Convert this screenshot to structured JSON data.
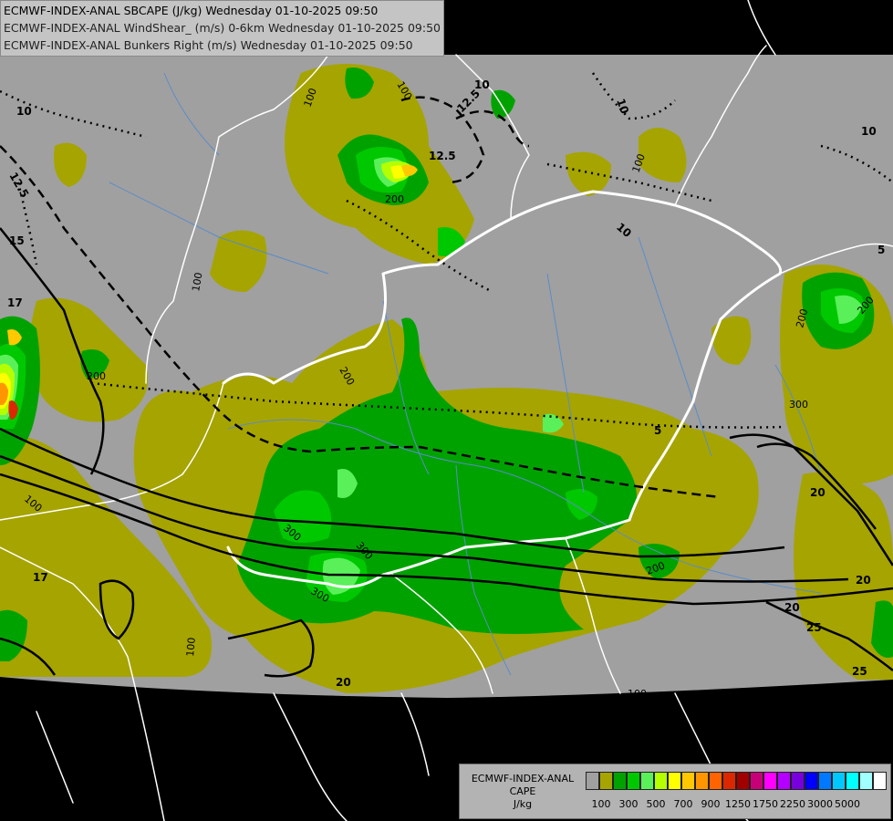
{
  "header": {
    "line1": "ECMWF-INDEX-ANAL SBCAPE (J/kg) Wednesday 01-10-2025 09:50",
    "line2": "ECMWF-INDEX-ANAL WindShear_ (m/s) 0-6km Wednesday 01-10-2025 09:50",
    "line3": "ECMWF-INDEX-ANAL Bunkers Right (m/s) Wednesday 01-10-2025 09:50"
  },
  "legend": {
    "title1": "ECMWF-INDEX-ANAL",
    "title2": "CAPE",
    "unit": "J/kg",
    "colors": [
      "#a0a0a0",
      "#a6a400",
      "#00a200",
      "#00c800",
      "#5af05a",
      "#b4ff00",
      "#ffff00",
      "#ffc800",
      "#ff9600",
      "#ff6400",
      "#dc2800",
      "#a00000",
      "#c80078",
      "#ff00ff",
      "#b400ff",
      "#7800dc",
      "#0000ff",
      "#0078ff",
      "#00c8ff",
      "#00ffff",
      "#a0ffff",
      "#ffffff"
    ],
    "tick_labels": [
      "100",
      "300",
      "500",
      "700",
      "900",
      "1250",
      "1750",
      "2250",
      "3000",
      "5000"
    ]
  },
  "contour_labels": {
    "cape": [
      "100",
      "100",
      "200",
      "200",
      "200",
      "200",
      "200",
      "300",
      "300",
      "300",
      "300",
      "100",
      "100",
      "100",
      "100",
      "100",
      "200"
    ],
    "shear": [
      "15",
      "17",
      "17",
      "20",
      "20",
      "20",
      "20",
      "25",
      "25"
    ],
    "bunkers": [
      "10",
      "10",
      "10",
      "12.5",
      "12.5",
      "12.5",
      "10",
      "10",
      "5",
      "5"
    ]
  },
  "colors": {
    "outside": "#000000",
    "domain": "#a0a0a0",
    "cape_100": "#a6a400",
    "cape_300": "#00a200",
    "cape_500": "#00c800",
    "cape_700": "#5af05a",
    "cape_900": "#b4ff00",
    "cape_1250": "#ffff00",
    "cape_1750": "#ffc800",
    "cape_2250": "#ff9600",
    "cape_3000": "#ff6400",
    "cape_5000": "#dc2800",
    "border": "#ffffff",
    "river": "#5a8cc8"
  }
}
